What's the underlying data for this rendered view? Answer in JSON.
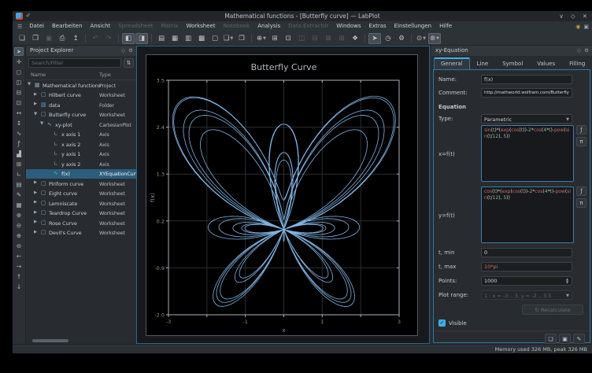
{
  "window": {
    "title": "Mathematical functions - [Butterfly curve] — LabPlot",
    "controls": [
      {
        "name": "minimize-icon",
        "glyph": "∨"
      },
      {
        "name": "maximize-icon",
        "glyph": "◇"
      },
      {
        "name": "close-icon",
        "glyph": "✕"
      }
    ]
  },
  "menubar": {
    "items": [
      {
        "label": "Datei",
        "enabled": true
      },
      {
        "label": "Bearbeiten",
        "enabled": true
      },
      {
        "label": "Ansicht",
        "enabled": true
      },
      {
        "label": "Spreadsheet",
        "enabled": false
      },
      {
        "label": "Matrix",
        "enabled": false
      },
      {
        "label": "Worksheet",
        "enabled": true
      },
      {
        "label": "Notebook",
        "enabled": false
      },
      {
        "label": "Analysis",
        "enabled": true
      },
      {
        "label": "Data Extractor",
        "enabled": false
      },
      {
        "label": "Windows",
        "enabled": true
      },
      {
        "label": "Extras",
        "enabled": true
      },
      {
        "label": "Einstellungen",
        "enabled": true
      },
      {
        "label": "Hilfe",
        "enabled": true
      }
    ],
    "right_icons": [
      {
        "name": "donate-icon",
        "glyph": "◉",
        "color": "#c49a3c"
      },
      {
        "name": "notifications-icon",
        "glyph": "▣",
        "color": "#9aa0a5"
      }
    ]
  },
  "toolbar": {
    "items": [
      {
        "name": "new-project-button",
        "glyph": "❏"
      },
      {
        "name": "open-project-button",
        "glyph": "❐"
      },
      {
        "name": "save-project-button",
        "glyph": "▣",
        "state": "disabled"
      },
      {
        "name": "print-button",
        "glyph": "⎙"
      },
      {
        "name": "export-button",
        "glyph": "↥"
      },
      {
        "sep": true
      },
      {
        "name": "undo-button",
        "glyph": "↶",
        "state": "disabled"
      },
      {
        "name": "redo-button",
        "glyph": "↷",
        "state": "disabled"
      },
      {
        "sep": true
      },
      {
        "name": "toggle-project-explorer-button",
        "glyph": "◧",
        "state": "active"
      },
      {
        "name": "toggle-properties-button",
        "glyph": "◨",
        "state": "active"
      },
      {
        "sep": true
      },
      {
        "name": "new-folder-button",
        "glyph": "▤"
      },
      {
        "name": "new-workbook-button",
        "glyph": "▦"
      },
      {
        "name": "new-spreadsheet-button",
        "glyph": "▥"
      },
      {
        "name": "new-matrix-button",
        "glyph": "▩"
      },
      {
        "name": "new-worksheet-button",
        "glyph": "▢"
      },
      {
        "name": "new-notebook-button",
        "glyph": "❏",
        "caret": true
      },
      {
        "name": "import-button",
        "glyph": "❒"
      },
      {
        "sep": true
      },
      {
        "name": "zoom-mode-button",
        "glyph": "⊕",
        "caret": true
      },
      {
        "name": "zoom-fit-button",
        "glyph": "⊞"
      },
      {
        "name": "zoom-original-button",
        "glyph": "⊡"
      },
      {
        "name": "cascade-windows-button",
        "glyph": "◫",
        "state": "disabled"
      },
      {
        "name": "tile-windows-button",
        "glyph": "⊟",
        "state": "disabled"
      },
      {
        "name": "close-window-button",
        "glyph": "⊠",
        "state": "disabled"
      },
      {
        "name": "next-window-button",
        "glyph": "⊞",
        "state": "disabled"
      },
      {
        "name": "fullscreen-button",
        "glyph": "❖"
      },
      {
        "sep": true
      },
      {
        "name": "select-mode-button",
        "glyph": "➤",
        "state": "active"
      },
      {
        "name": "navigate-mode-button",
        "glyph": "◷"
      },
      {
        "name": "zoom-select-mode-button",
        "glyph": "⚙"
      },
      {
        "sep": true
      },
      {
        "name": "magnification-button",
        "glyph": "⊙",
        "caret": true
      },
      {
        "name": "presenter-mode-button",
        "glyph": "⊛",
        "caret": true,
        "state": "active"
      }
    ]
  },
  "plot_toolbar": {
    "items": [
      {
        "name": "plot-select-mode-button",
        "glyph": "➤",
        "state": "active"
      },
      {
        "name": "plot-crosshair-button",
        "glyph": "✛"
      },
      {
        "name": "plot-zoom-select-button",
        "glyph": "◻"
      },
      {
        "name": "plot-zoom-x-select-button",
        "glyph": "◫"
      },
      {
        "name": "plot-zoom-y-select-button",
        "glyph": "⊟"
      },
      {
        "name": "plot-auto-scale-button",
        "glyph": "⊡"
      },
      {
        "name": "plot-auto-scale-x-button",
        "glyph": "↔"
      },
      {
        "name": "plot-auto-scale-y-button",
        "glyph": "↕"
      },
      {
        "name": "add-curve-button",
        "glyph": "∿"
      },
      {
        "name": "add-equation-curve-button",
        "glyph": "ƒ"
      },
      {
        "name": "add-histogram-button",
        "glyph": "▟"
      },
      {
        "name": "add-boxplot-button",
        "glyph": "⊞"
      },
      {
        "name": "add-axis-button",
        "glyph": "∟"
      },
      {
        "name": "add-legend-button",
        "glyph": "▤"
      },
      {
        "name": "add-text-label-button",
        "glyph": "✎"
      },
      {
        "name": "add-image-button",
        "glyph": "▦"
      },
      {
        "name": "zoom-in-x-button",
        "glyph": "⊕"
      },
      {
        "name": "zoom-out-x-button",
        "glyph": "⊖"
      },
      {
        "name": "zoom-in-y-button",
        "glyph": "⊕"
      },
      {
        "name": "zoom-out-y-button",
        "glyph": "⊖"
      },
      {
        "name": "shift-left-x-button",
        "glyph": "←"
      },
      {
        "name": "shift-right-x-button",
        "glyph": "→"
      },
      {
        "name": "shift-up-y-button",
        "glyph": "↑"
      },
      {
        "name": "shift-down-y-button",
        "glyph": "↓"
      }
    ]
  },
  "project_explorer": {
    "title": "Project Explorer",
    "search_placeholder": "Search/Filter",
    "columns": {
      "name": "Name",
      "type": "Type"
    },
    "rows": [
      {
        "indent": 0,
        "expander": "open",
        "icon": "project",
        "name": "Mathematical functions",
        "type": "Project"
      },
      {
        "indent": 1,
        "expander": "closed",
        "icon": "worksheet",
        "name": "Hilbert curve",
        "type": "Worksheet"
      },
      {
        "indent": 1,
        "expander": "closed",
        "icon": "folder",
        "name": "data",
        "type": "Folder"
      },
      {
        "indent": 1,
        "expander": "open",
        "icon": "worksheet",
        "name": "Butterfly curve",
        "type": "Worksheet"
      },
      {
        "indent": 2,
        "expander": "open",
        "icon": "plot",
        "name": "xy-plot",
        "type": "CartesianPlot"
      },
      {
        "indent": 3,
        "expander": "none",
        "icon": "axis",
        "name": "x axis 1",
        "type": "Axis"
      },
      {
        "indent": 3,
        "expander": "none",
        "icon": "axis",
        "name": "x axis 2",
        "type": "Axis"
      },
      {
        "indent": 3,
        "expander": "none",
        "icon": "axis",
        "name": "y axis 1",
        "type": "Axis"
      },
      {
        "indent": 3,
        "expander": "none",
        "icon": "axis",
        "name": "y axis 2",
        "type": "Axis"
      },
      {
        "indent": 3,
        "expander": "none",
        "icon": "curve",
        "name": "f(x)",
        "type": "XYEquationCurve",
        "selected": true
      },
      {
        "indent": 1,
        "expander": "closed",
        "icon": "worksheet",
        "name": "Piriform curve",
        "type": "Worksheet"
      },
      {
        "indent": 1,
        "expander": "closed",
        "icon": "worksheet",
        "name": "Eight curve",
        "type": "Worksheet"
      },
      {
        "indent": 1,
        "expander": "closed",
        "icon": "worksheet",
        "name": "Lemniscate",
        "type": "Worksheet"
      },
      {
        "indent": 1,
        "expander": "closed",
        "icon": "worksheet",
        "name": "Teardrop Curve",
        "type": "Worksheet"
      },
      {
        "indent": 1,
        "expander": "closed",
        "icon": "worksheet",
        "name": "Rose Curve",
        "type": "Worksheet"
      },
      {
        "indent": 1,
        "expander": "closed",
        "icon": "worksheet",
        "name": "Devil's Curve",
        "type": "Worksheet"
      }
    ]
  },
  "chart_data": {
    "type": "line",
    "title": "Butterfly Curve",
    "xlabel": "x",
    "ylabel": "f(x)",
    "xlim": [
      -3,
      3
    ],
    "ylim": [
      -2,
      3.5
    ],
    "x_ticks": [
      -3,
      -2,
      -1,
      0,
      1,
      2,
      3
    ],
    "x_tick_labels": [
      "-3",
      "",
      "-1",
      "",
      "1",
      "",
      "3"
    ],
    "y_ticks": [
      -2,
      -0.9,
      0.2,
      1.3,
      2.4,
      3.5
    ],
    "y_tick_labels": [
      "-2.0",
      "-0.9",
      "0.2",
      "1.3",
      "2.4",
      "3.5"
    ],
    "grid": true,
    "legend": false,
    "curve_color": "#7fb3e2",
    "equation": {
      "type": "Parametric",
      "x": "sin(t)*(exp(cos(t))-2*cos(4*t)-pow(sin(t/12), 5))",
      "y": "cos(t)*(exp(cos(t))-2*cos(4*t)-pow(sin(t/12), 5))",
      "t_min": "0",
      "t_max": "10*pi",
      "points": 1000
    }
  },
  "properties": {
    "title": "xy-Equation",
    "tabs": [
      "General",
      "Line",
      "Symbol",
      "Values",
      "Filling"
    ],
    "active_tab": "General",
    "name_label": "Name:",
    "name_value": "f(x)",
    "comment_label": "Comment:",
    "comment_value": "http://mathworld.wolfram.com/ButterflyCurve.html",
    "section_equation": "Equation",
    "type_label": "Type:",
    "type_value": "Parametric",
    "x_label": "x=f(t)",
    "y_label": "y=f(t)",
    "tmin_label": "t, min",
    "tmin_value": "0",
    "tmax_label": "t, max",
    "tmax_value": "10*pi",
    "points_label": "Points:",
    "points_value": "1000",
    "plot_range_label": "Plot range:",
    "plot_range_value": "1 : x = -3 .. 3, y = -2 .. 3.5",
    "recalculate_label": "Recalculate",
    "visible_label": "Visible",
    "function_button_glyph": "ƒ",
    "constants_button_glyph": "π",
    "bottom_buttons": [
      {
        "name": "template-load-button",
        "glyph": "❏"
      },
      {
        "name": "template-save-button",
        "glyph": "▣"
      },
      {
        "name": "template-edit-button",
        "glyph": "✎"
      }
    ]
  },
  "statusbar": {
    "memory": "Memory used 326 MB, peak 326 MB"
  }
}
